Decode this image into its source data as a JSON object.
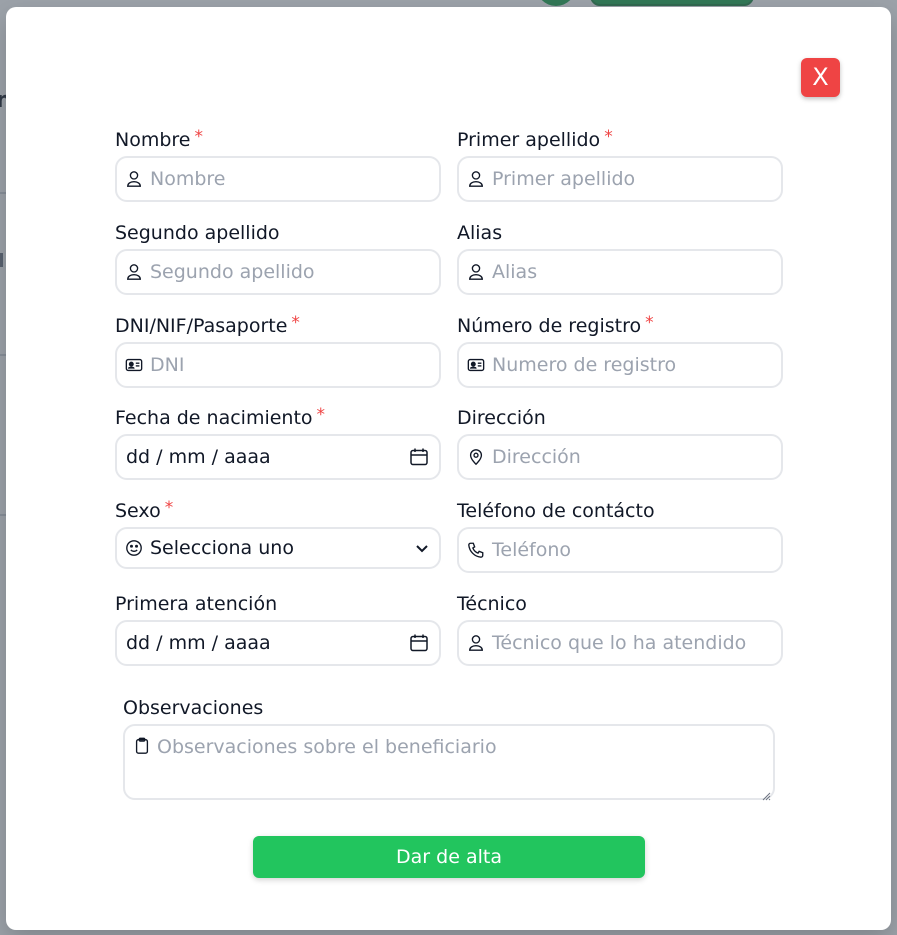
{
  "modal": {
    "close_label": "X",
    "submit_label": "Dar de alta"
  },
  "fields": {
    "nombre": {
      "label": "Nombre",
      "placeholder": "Nombre",
      "required": "*"
    },
    "primer_apellido": {
      "label": "Primer apellido",
      "placeholder": "Primer apellido",
      "required": "*"
    },
    "segundo_apellido": {
      "label": "Segundo apellido",
      "placeholder": "Segundo apellido"
    },
    "alias": {
      "label": "Alias",
      "placeholder": "Alias"
    },
    "dni": {
      "label": "DNI/NIF/Pasaporte",
      "placeholder": "DNI",
      "required": "*"
    },
    "registro": {
      "label": "Número de registro",
      "placeholder": "Numero de registro",
      "required": "*"
    },
    "fecha_nacimiento": {
      "label": "Fecha de nacimiento",
      "value": "dd / mm / aaaa",
      "required": "*"
    },
    "direccion": {
      "label": "Dirección",
      "placeholder": "Dirección"
    },
    "sexo": {
      "label": "Sexo",
      "value": "Selecciona uno",
      "required": "*"
    },
    "telefono": {
      "label": "Teléfono de contácto",
      "placeholder": "Teléfono"
    },
    "primera_atencion": {
      "label": "Primera atención",
      "value": "dd / mm / aaaa"
    },
    "tecnico": {
      "label": "Técnico",
      "placeholder": "Técnico que lo ha atendido"
    },
    "observaciones": {
      "label": "Observaciones",
      "placeholder": "Observaciones sobre el beneficiario"
    }
  },
  "colors": {
    "close": "#ef4444",
    "submit": "#22c55e",
    "required": "#ef4444",
    "placeholder": "#9ca3af",
    "border": "#e5e7eb"
  },
  "icons": {
    "user": "user-icon",
    "id_card": "id-card-icon",
    "calendar": "calendar-icon",
    "location": "map-pin-icon",
    "smile": "smile-icon",
    "phone": "phone-icon",
    "clipboard": "clipboard-icon",
    "chevron": "chevron-down-icon"
  }
}
